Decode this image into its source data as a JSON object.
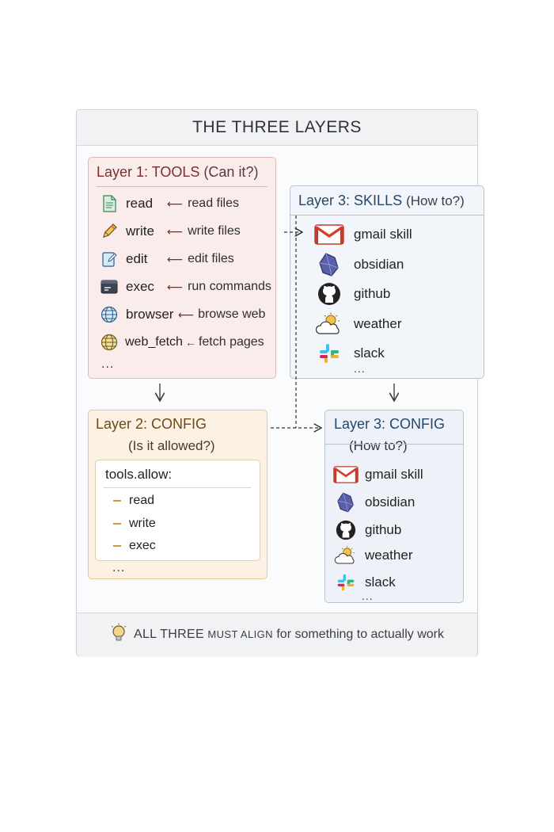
{
  "header": {
    "title": "THE THREE LAYERS"
  },
  "layer1": {
    "title_main": "Layer 1: TOOLS",
    "title_paren": "(Can it?)",
    "tools": [
      {
        "name": "read",
        "desc": "read files",
        "icon": "document-icon"
      },
      {
        "name": "write",
        "desc": "write files",
        "icon": "pencil-icon"
      },
      {
        "name": "edit",
        "desc": "edit files",
        "icon": "edit-icon"
      },
      {
        "name": "exec",
        "desc": "run commands",
        "icon": "terminal-icon"
      },
      {
        "name": "browser",
        "desc": "browse web",
        "icon": "globe-icon"
      },
      {
        "name": "web_fetch",
        "desc": "fetch pages",
        "icon": "web-globe-icon"
      }
    ],
    "more": "..."
  },
  "layer2": {
    "title": "Layer 2: CONFIG",
    "subtitle": "(Is it allowed?)",
    "key": "tools.allow:",
    "items": [
      "read",
      "write",
      "exec"
    ],
    "more": "..."
  },
  "layer3_skills": {
    "title_main": "Layer 3: SKILLS",
    "title_paren": "(How to?)",
    "skills": [
      {
        "name": "gmail skill",
        "icon": "gmail-icon"
      },
      {
        "name": "obsidian",
        "icon": "obsidian-icon"
      },
      {
        "name": "github",
        "icon": "github-icon"
      },
      {
        "name": "weather",
        "icon": "weather-icon"
      },
      {
        "name": "slack",
        "icon": "slack-icon"
      }
    ],
    "more": "..."
  },
  "layer3_config": {
    "title": "Layer 3: CONFIG",
    "subtitle": "(How to?)",
    "skills": [
      {
        "name": "gmail skill",
        "icon": "gmail-icon"
      },
      {
        "name": "obsidian",
        "icon": "obsidian-icon"
      },
      {
        "name": "github",
        "icon": "github-icon"
      },
      {
        "name": "weather",
        "icon": "weather-icon"
      },
      {
        "name": "slack",
        "icon": "slack-icon"
      }
    ],
    "more": "..."
  },
  "footer": {
    "icon": "lightbulb-icon",
    "strong": "ALL THREE",
    "caps": "MUST ALIGN",
    "rest": "for something to actually work"
  },
  "colors": {
    "layer1_bg": "#fbecec",
    "layer2_bg": "#fcf1e2",
    "layer3_bg": "#f2f5fa",
    "accent_red": "#7a2f2f",
    "accent_blue": "#24476b"
  }
}
